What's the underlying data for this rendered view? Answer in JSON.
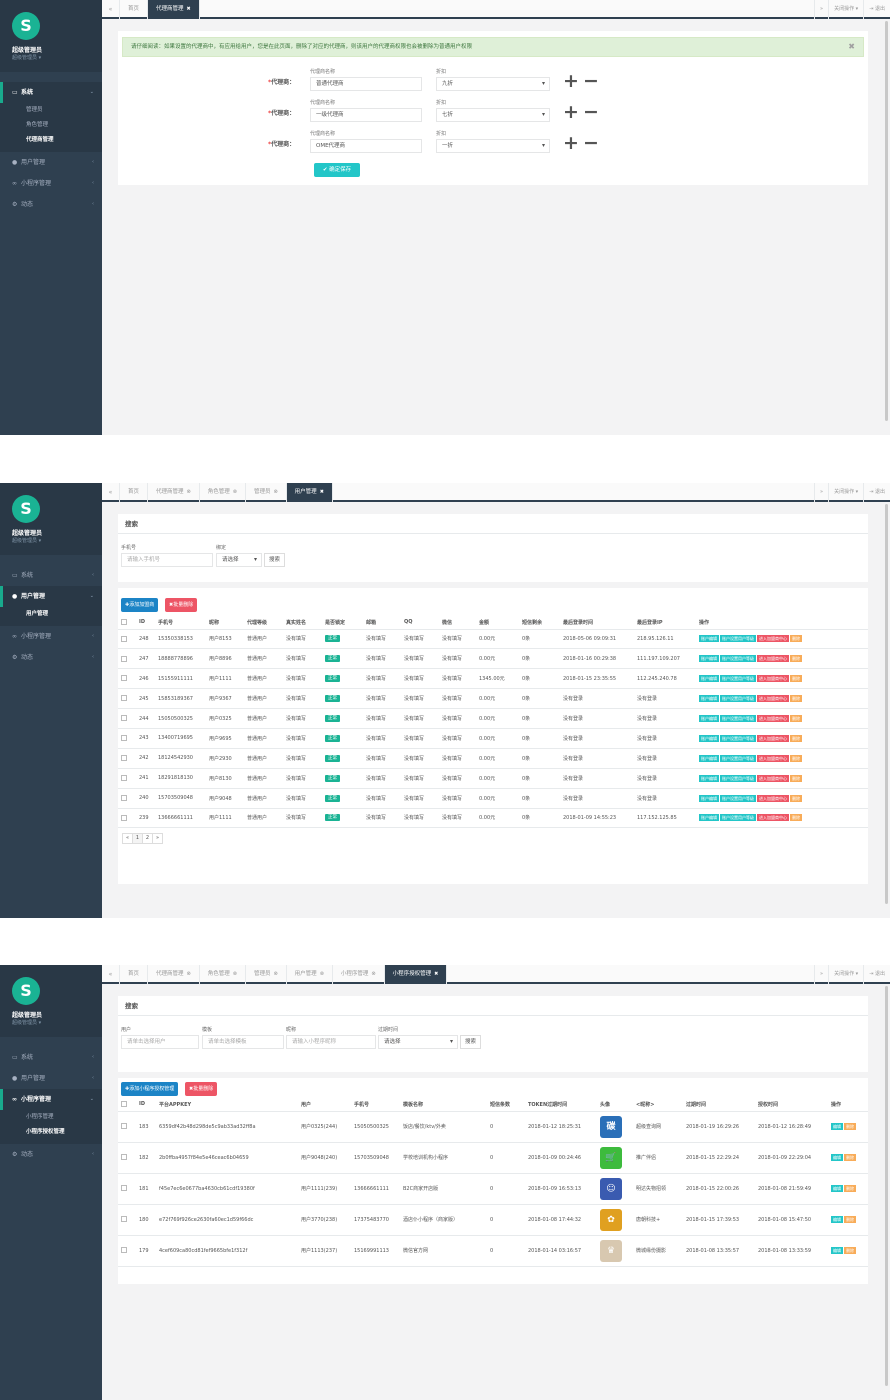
{
  "sidebar": {
    "user_name": "超级管理员",
    "user_role": "超级管理员 ▾",
    "logo_glyph": "S",
    "items": [
      {
        "label": "系统",
        "icon": "monitor-icon",
        "sub": [
          "管理员",
          "角色管理",
          "代理商管理"
        ]
      },
      {
        "label": "用户管理",
        "icon": "user-icon",
        "sub": [
          "用户管理"
        ]
      },
      {
        "label": "小程序管理",
        "icon": "link-icon",
        "sub": [
          "小程序管理",
          "小程序授权管理"
        ]
      },
      {
        "label": "动态",
        "icon": "cogs-icon",
        "sub": []
      }
    ]
  },
  "tabbar": {
    "back": "«",
    "forward": "»",
    "close_ops": "关闭操作 ▾",
    "logout": "退出",
    "tabs": [
      "首页",
      "代理商管理",
      "角色管理",
      "管理员",
      "用户管理",
      "小程序管理",
      "小程序授权管理"
    ]
  },
  "agent_form": {
    "notice": "请仔细阅读：如果设置的代理商中，有应用给用户，您是在此页面，删除了对应的代理商，则该用户的代理商权限也会被删除为普通用户权限",
    "row_label": "代理商：",
    "name_caption": "代理商名称",
    "discount_caption": "折扣",
    "rows": [
      {
        "name": "普通代理商",
        "discount": "九折"
      },
      {
        "name": "一级代理商",
        "discount": "七折"
      },
      {
        "name": "OME代理商",
        "discount": "一折"
      }
    ],
    "plus": "+",
    "minus": "−",
    "save": "✔ 确定保存"
  },
  "users": {
    "search_title": "搜索",
    "phone_label": "手机号",
    "phone_placeholder": "请输入手机号",
    "bind_label": "绑定",
    "bind_value": "请选择",
    "search_btn": "搜索",
    "add_btn": "✚添加加盟商",
    "del_btn": "✖批量删除",
    "columns": [
      "",
      "ID",
      "手机号",
      "昵称",
      "代理等级",
      "真实姓名",
      "是否锁定",
      "邮箱",
      "QQ",
      "微信",
      "金额",
      "短信剩余",
      "最后登录时间",
      "最后登录IP",
      "操作"
    ],
    "status_ok": "正常",
    "ops": [
      "账户编辑",
      "账户设置用户等级",
      "进入加盟商中心",
      "删除"
    ],
    "rows": [
      [
        "248",
        "15350338153",
        "用户8153",
        "普通用户",
        "没有填写",
        "没有填写",
        "没有填写",
        "没有填写",
        "0.00元",
        "0条",
        "2018-05-06 09:09:31",
        "218.95.126.11"
      ],
      [
        "247",
        "18888778896",
        "用户8896",
        "普通用户",
        "没有填写",
        "没有填写",
        "没有填写",
        "没有填写",
        "0.00元",
        "0条",
        "2018-01-16 00:29:38",
        "111.197.109.207"
      ],
      [
        "246",
        "15155911111",
        "用户1111",
        "普通用户",
        "没有填写",
        "没有填写",
        "没有填写",
        "没有填写",
        "1345.00元",
        "0条",
        "2018-01-15 23:35:55",
        "112.245.240.78"
      ],
      [
        "245",
        "15853189367",
        "用户9367",
        "普通用户",
        "没有填写",
        "没有填写",
        "没有填写",
        "没有填写",
        "0.00元",
        "0条",
        "没有登录",
        "没有登录"
      ],
      [
        "244",
        "15050500325",
        "用户0325",
        "普通用户",
        "没有填写",
        "没有填写",
        "没有填写",
        "没有填写",
        "0.00元",
        "0条",
        "没有登录",
        "没有登录"
      ],
      [
        "243",
        "13400719695",
        "用户9695",
        "普通用户",
        "没有填写",
        "没有填写",
        "没有填写",
        "没有填写",
        "0.00元",
        "0条",
        "没有登录",
        "没有登录"
      ],
      [
        "242",
        "18124542930",
        "用户2930",
        "普通用户",
        "没有填写",
        "没有填写",
        "没有填写",
        "没有填写",
        "0.00元",
        "0条",
        "没有登录",
        "没有登录"
      ],
      [
        "241",
        "18291818130",
        "用户8130",
        "普通用户",
        "没有填写",
        "没有填写",
        "没有填写",
        "没有填写",
        "0.00元",
        "0条",
        "没有登录",
        "没有登录"
      ],
      [
        "240",
        "15703509048",
        "用户9048",
        "普通用户",
        "没有填写",
        "没有填写",
        "没有填写",
        "没有填写",
        "0.00元",
        "0条",
        "没有登录",
        "没有登录"
      ],
      [
        "239",
        "13666661111",
        "用户1111",
        "普通用户",
        "没有填写",
        "没有填写",
        "没有填写",
        "没有填写",
        "0.00元",
        "0条",
        "2018-01-09 14:55:23",
        "117.152.125.85"
      ]
    ],
    "pager": [
      "«",
      "1",
      "2",
      "»"
    ]
  },
  "auth": {
    "search_title": "搜索",
    "user_label": "用户",
    "user_placeholder": "请单击选择用户",
    "template_label": "模板",
    "template_placeholder": "请单击选择模板",
    "nick_label": "昵称",
    "nick_placeholder": "请输入小程序昵称",
    "expire_label": "过期时间",
    "expire_value": "请选择",
    "search_btn": "搜索",
    "add_btn": "✚添加小程序授权管理",
    "del_btn": "✖批量删除",
    "columns": [
      "",
      "ID",
      "平台APPKEY",
      "用户",
      "手机号",
      "模板名称",
      "短信条数",
      "TOKEN过期时间",
      "头像",
      "<昵称>",
      "过期时间",
      "授权时间",
      "操作"
    ],
    "ops": [
      "编辑",
      "删除"
    ],
    "rows": [
      {
        "id": "183",
        "appkey": "6359df42b48d298de5c9ab33ad32ff8a",
        "user": "用户0325(244)",
        "phone": "15050500325",
        "template": "饭店/餐饮/ktv/外卖",
        "sms": "0",
        "token": "2018-01-12 18:25:31",
        "avatar_color": "#2a6fb8",
        "avatar_text": "碳",
        "nick": "超级查询网",
        "expire": "2018-01-19 16:29:26",
        "auth": "2018-01-12 16:28:49"
      },
      {
        "id": "182",
        "appkey": "2b0ffba4957f84e5e46ceac6b04659",
        "user": "用户9048(240)",
        "phone": "15703509048",
        "template": "学校培训机构小程序",
        "sms": "0",
        "token": "2018-01-09 00:24:46",
        "avatar_color": "#3dbb3d",
        "avatar_text": "🛒",
        "nick": "推广伴侣",
        "expire": "2018-01-15 22:29:24",
        "auth": "2018-01-09 22:29:04"
      },
      {
        "id": "181",
        "appkey": "f45e7ec6e0677ba4630cb61cdf19380f",
        "user": "用户1111(239)",
        "phone": "13666661111",
        "template": "B2C商家开店版",
        "sms": "0",
        "token": "2018-01-09 16:53:13",
        "avatar_color": "#3a5bb0",
        "avatar_text": "☺",
        "nick": "明达失物招领",
        "expire": "2018-01-15 22:00:26",
        "auth": "2018-01-08 21:59:49"
      },
      {
        "id": "180",
        "appkey": "e72f769f926ce2630fa60ec1d59f66dc",
        "user": "用户3770(238)",
        "phone": "17375483770",
        "template": "酒店仆小程序（商家版）",
        "sms": "0",
        "token": "2018-01-08 17:44:32",
        "avatar_color": "#e0a020",
        "avatar_text": "✿",
        "nick": "唐朝科技+",
        "expire": "2018-01-15 17:39:53",
        "auth": "2018-01-08 15:47:50"
      },
      {
        "id": "179",
        "appkey": "4cef609ca80cd81fef9665bfe1f312f",
        "user": "用户1113(237)",
        "phone": "15169991113",
        "template": "微信官方网",
        "sms": "0",
        "token": "2018-01-14 03:16:57",
        "avatar_color": "#d8c8b0",
        "avatar_text": "♛",
        "nick": "微城缘份摄影",
        "expire": "2018-01-08 13:35:57",
        "auth": "2018-01-08 13:33:59"
      }
    ]
  }
}
